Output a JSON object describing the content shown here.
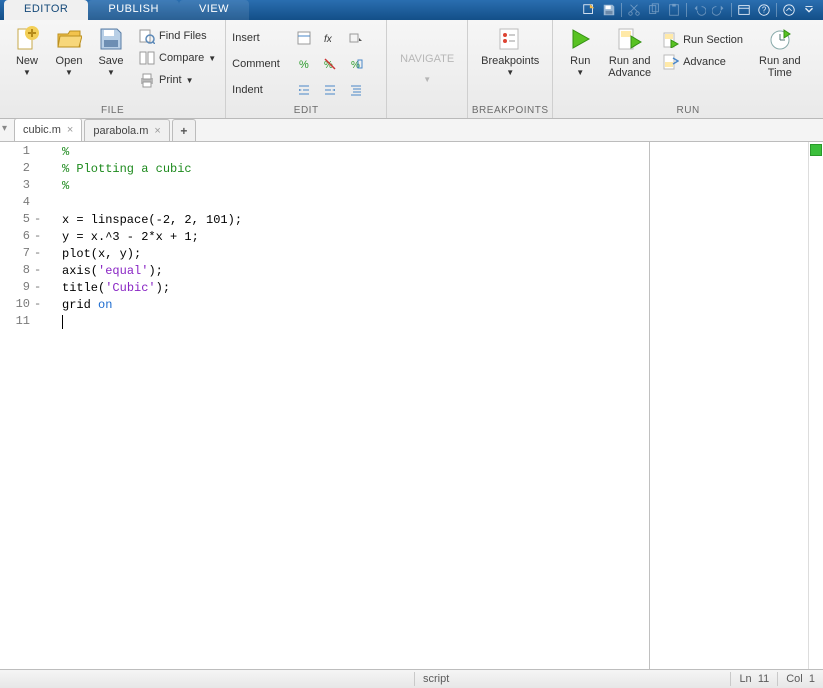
{
  "tabs": {
    "editor": "EDITOR",
    "publish": "PUBLISH",
    "view": "VIEW"
  },
  "ribbon": {
    "file": {
      "new": "New",
      "open": "Open",
      "save": "Save",
      "findfiles": "Find Files",
      "compare": "Compare",
      "print": "Print",
      "label": "FILE"
    },
    "edit": {
      "insert": "Insert",
      "comment": "Comment",
      "indent": "Indent",
      "label": "EDIT"
    },
    "navigate": {
      "label": "NAVIGATE"
    },
    "breakpoints": {
      "btn": "Breakpoints",
      "label": "BREAKPOINTS"
    },
    "run": {
      "run": "Run",
      "runadv": "Run and\nAdvance",
      "runsec": "Run Section",
      "advance": "Advance",
      "runtime": "Run and\nTime",
      "label": "RUN"
    }
  },
  "files": {
    "active": "cubic.m",
    "other": "parabola.m"
  },
  "code": {
    "lines": [
      {
        "n": "1",
        "ind": " ",
        "tokens": [
          {
            "t": "%",
            "c": "c-com"
          }
        ]
      },
      {
        "n": "2",
        "ind": " ",
        "tokens": [
          {
            "t": "% Plotting a cubic",
            "c": "c-com"
          }
        ]
      },
      {
        "n": "3",
        "ind": " ",
        "tokens": [
          {
            "t": "%",
            "c": "c-com"
          }
        ]
      },
      {
        "n": "4",
        "ind": " ",
        "tokens": []
      },
      {
        "n": "5",
        "ind": "-",
        "tokens": [
          {
            "t": "x = linspace(-2, 2, 101);",
            "c": ""
          }
        ]
      },
      {
        "n": "6",
        "ind": "-",
        "tokens": [
          {
            "t": "y = x.^3 - 2*x + 1;",
            "c": ""
          }
        ]
      },
      {
        "n": "7",
        "ind": "-",
        "tokens": [
          {
            "t": "plot(x, y);",
            "c": ""
          }
        ]
      },
      {
        "n": "8",
        "ind": "-",
        "tokens": [
          {
            "t": "axis(",
            "c": ""
          },
          {
            "t": "'equal'",
            "c": "c-str"
          },
          {
            "t": ");",
            "c": ""
          }
        ]
      },
      {
        "n": "9",
        "ind": "-",
        "tokens": [
          {
            "t": "title(",
            "c": ""
          },
          {
            "t": "'Cubic'",
            "c": "c-str"
          },
          {
            "t": ");",
            "c": ""
          }
        ]
      },
      {
        "n": "10",
        "ind": "-",
        "tokens": [
          {
            "t": "grid ",
            "c": ""
          },
          {
            "t": "on",
            "c": "c-kw"
          }
        ]
      },
      {
        "n": "11",
        "ind": " ",
        "tokens": [],
        "cursor": true
      }
    ]
  },
  "status": {
    "type": "script",
    "ln": "Ln",
    "lnv": "11",
    "col": "Col",
    "colv": "1"
  }
}
